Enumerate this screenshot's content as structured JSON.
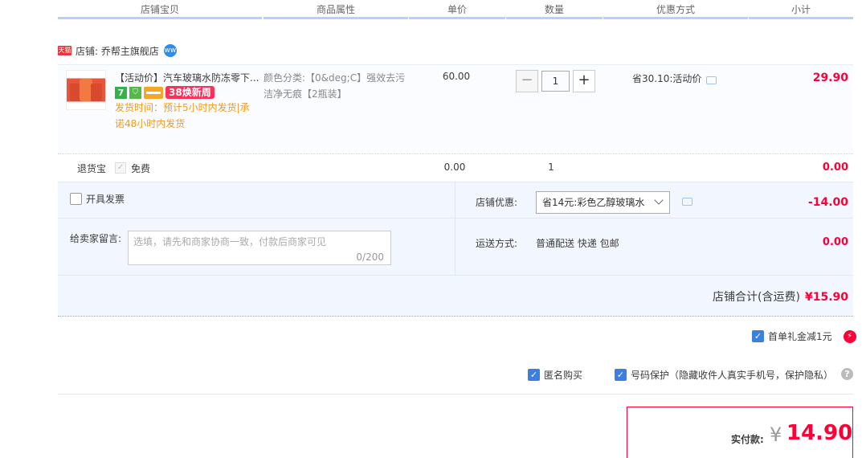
{
  "header": {
    "columns": [
      "店铺宝贝",
      "商品属性",
      "单价",
      "数量",
      "优惠方式",
      "小计"
    ]
  },
  "shop": {
    "badge": "天猫",
    "label": "店铺: 乔帮主旗舰店",
    "chat_icon_text": "ww"
  },
  "item": {
    "title": "【活动价】汽车玻璃水防冻零下...",
    "badges": {
      "seven": "7",
      "promo": "38焕新周"
    },
    "ship_time": "发货时间：预计5小时内发货|承诺48小时内发货",
    "attr": "颜色分类:【0&deg;C】强效去污洁净无痕【2瓶装】",
    "price": "60.00",
    "quantity": "1",
    "discount": "省30.10:活动价",
    "subtotal": "29.90"
  },
  "tuihuobao": {
    "label": "退货宝",
    "option": "免费",
    "price": "0.00",
    "quantity": "1",
    "total": "0.00"
  },
  "options": {
    "invoice_label": "开具发票",
    "message_label": "给卖家留言:",
    "message_placeholder": "选填，请先和商家协商一致，付款后商家可见",
    "message_counter": "0/200",
    "shop_discount_label": "店铺优惠:",
    "shop_discount_selected": "省14元:彩色乙醇玻璃水",
    "shop_discount_value": "-14.00",
    "shipping_label": "运送方式:",
    "shipping_value": "普通配送 快递 包邮",
    "shipping_fee": "0.00"
  },
  "shop_total": {
    "label": "店铺合计(含运费)",
    "amount": "¥15.90"
  },
  "extras": {
    "gift": "首单礼金减1元",
    "anonymous": "匿名购买",
    "privacy": "号码保护（隐藏收件人真实手机号，保护隐私）"
  },
  "payment": {
    "label": "实付款:",
    "currency": "¥",
    "amount": "14.90"
  },
  "colors": {
    "price_red": "#ff0036",
    "accent_blue": "#3d7fe0",
    "ship_orange": "#f29a1a"
  }
}
